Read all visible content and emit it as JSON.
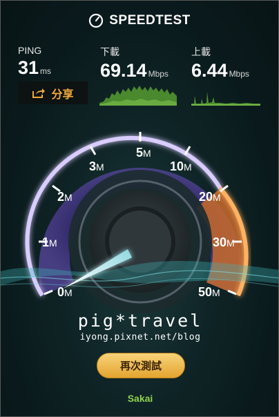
{
  "app": {
    "title": "SPEEDTEST",
    "logo_icon": "gauge-icon"
  },
  "stats": {
    "ping": {
      "label": "PING",
      "value": "31",
      "unit": "ms"
    },
    "download": {
      "label": "下載",
      "value": "69.14",
      "unit": "Mbps"
    },
    "upload": {
      "label": "上載",
      "value": "6.44",
      "unit": "Mbps"
    }
  },
  "share": {
    "label": "分享",
    "icon": "share-arrow-icon"
  },
  "gauge": {
    "ticks": [
      {
        "label": "0",
        "unit": "M"
      },
      {
        "label": "1",
        "unit": "M"
      },
      {
        "label": "2",
        "unit": "M"
      },
      {
        "label": "3",
        "unit": "M"
      },
      {
        "label": "5",
        "unit": "M"
      },
      {
        "label": "10",
        "unit": "M"
      },
      {
        "label": "20",
        "unit": "M"
      },
      {
        "label": "30",
        "unit": "M"
      },
      {
        "label": "50",
        "unit": "M"
      }
    ],
    "needle_value_mbps": 0,
    "active_color": "#8a6bd6",
    "upload_arc_color": "#e8873a"
  },
  "watermark": {
    "main": "pig*travel",
    "sub": "iyong.pixnet.net/blog"
  },
  "retest": {
    "label": "再次測試"
  },
  "server": {
    "name": "Sakai"
  },
  "colors": {
    "accent_orange": "#f2a93b",
    "graph_green": "#5faa3a",
    "server_green": "#8fd14f"
  }
}
